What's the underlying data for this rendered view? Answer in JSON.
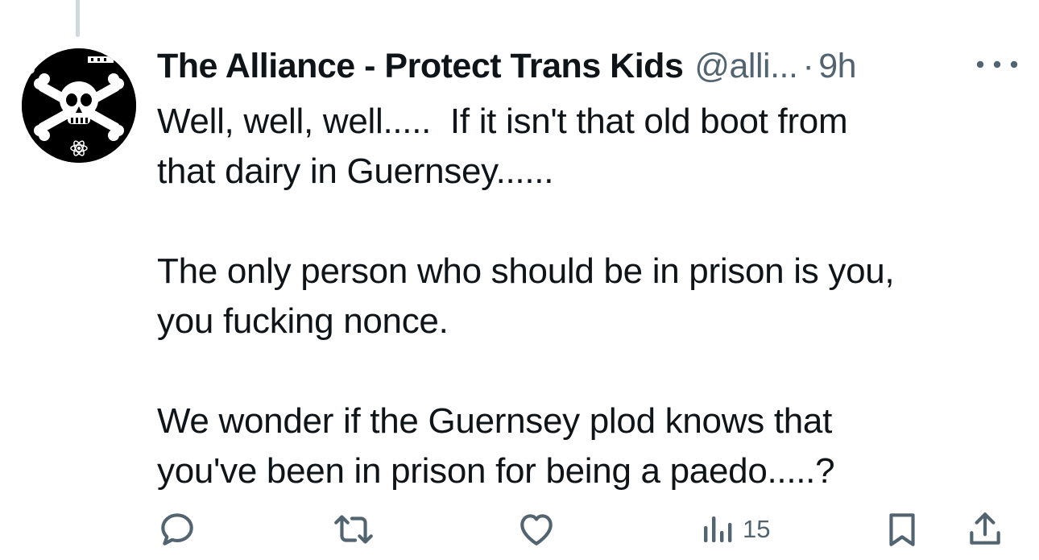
{
  "tweet": {
    "display_name": "The Alliance - Protect Trans Kids",
    "handle": "@alli...",
    "separator": "·",
    "time": "9h",
    "text_paragraphs": [
      [
        "Well, well, well.....  If it isn't that old boot from",
        "that dairy in Guernsey......"
      ],
      [
        "The only person who should be in prison is you,",
        "you fucking nonce."
      ],
      [
        "We wonder if the Guernsey plod knows that",
        "you've been in prison for being a paedo.....?"
      ]
    ],
    "views_count": "15"
  },
  "icons": {
    "avatar": "skull-crossbones-avatar",
    "more": "more-horizontal-icon",
    "reply": "reply-icon",
    "repost": "repost-icon",
    "like": "heart-icon",
    "views": "views-icon",
    "bookmark": "bookmark-icon",
    "share": "share-icon"
  },
  "colors": {
    "text_primary": "#0f1419",
    "text_secondary": "#536471",
    "thread_line": "#cfd9de",
    "avatar_bg": "#000000"
  }
}
